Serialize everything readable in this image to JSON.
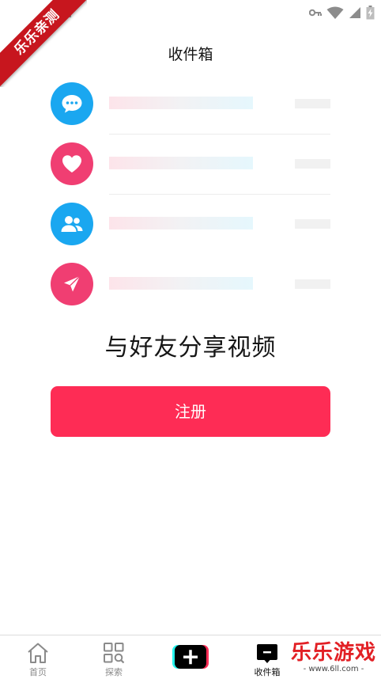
{
  "status_bar": {
    "icons": [
      "key-icon",
      "wifi-icon",
      "signal-icon",
      "battery-charging-icon"
    ]
  },
  "watermark": {
    "ribbon_text": "乐乐亲测",
    "corner_text": "乐乐游戏",
    "corner_url": "- www.6ll.com -"
  },
  "header": {
    "title": "收件箱"
  },
  "rows": [
    {
      "icon": "chat-bubble-icon",
      "color": "#1aa7f0"
    },
    {
      "icon": "heart-icon",
      "color": "#f03e72"
    },
    {
      "icon": "people-icon",
      "color": "#1aa7f0"
    },
    {
      "icon": "send-icon",
      "color": "#f03e72"
    }
  ],
  "main": {
    "headline": "与好友分享视频",
    "register_label": "注册"
  },
  "bottom_nav": {
    "items": [
      {
        "label": "首页",
        "icon": "home-icon"
      },
      {
        "label": "探索",
        "icon": "discover-icon"
      },
      {
        "label": "",
        "icon": "create-plus-icon"
      },
      {
        "label": "收件箱",
        "icon": "inbox-icon"
      }
    ]
  },
  "colors": {
    "accent": "#fe2c55",
    "blue": "#1aa7f0",
    "pink": "#f03e72"
  }
}
